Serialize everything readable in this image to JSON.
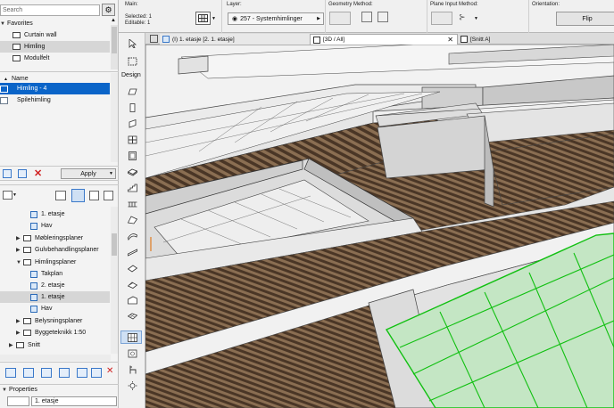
{
  "left_panel": {
    "search_placeholder": "Search",
    "favorites_label": "Favorites",
    "favorites": [
      "Curtain wall",
      "Himling",
      "Modulfelt"
    ],
    "name_header": "Name",
    "list": [
      "Himling - 4",
      "Spilehimling"
    ],
    "apply_label": "Apply",
    "tree": [
      {
        "label": "1. etasje"
      },
      {
        "label": "Hav"
      },
      {
        "label": "Møbleringsplaner"
      },
      {
        "label": "Gulvbehandlingsplaner"
      },
      {
        "label": "Himlingsplaner"
      },
      {
        "label": "Takplan"
      },
      {
        "label": "2. etasje"
      },
      {
        "label": "1. etasje"
      },
      {
        "label": "Hav"
      },
      {
        "label": "Belysningsplaner"
      },
      {
        "label": "Byggeteknikk 1:50"
      },
      {
        "label": "Snitt"
      }
    ],
    "properties_label": "Properties",
    "properties_value": "1. etasje"
  },
  "toolbox": {
    "design_label": "Design"
  },
  "info_box": {
    "main_label": "Main:",
    "selected": "Selected: 1",
    "editable": "Editable: 1",
    "layer_label": "Layer:",
    "layer_value": "257 - Systemhimlinger",
    "geometry_label": "Geometry Method:",
    "plane_label": "Plane Input Method:",
    "orientation_label": "Orientation:",
    "flip_label": "Flip"
  },
  "tabs": [
    "(I) 1. etasje [2. 1. etasje]",
    "[3D / All]",
    "[Snitt A]"
  ],
  "colors": {
    "selection": "#0a64c8",
    "ceiling_green": "#12c012",
    "wood": "#7a6048"
  }
}
